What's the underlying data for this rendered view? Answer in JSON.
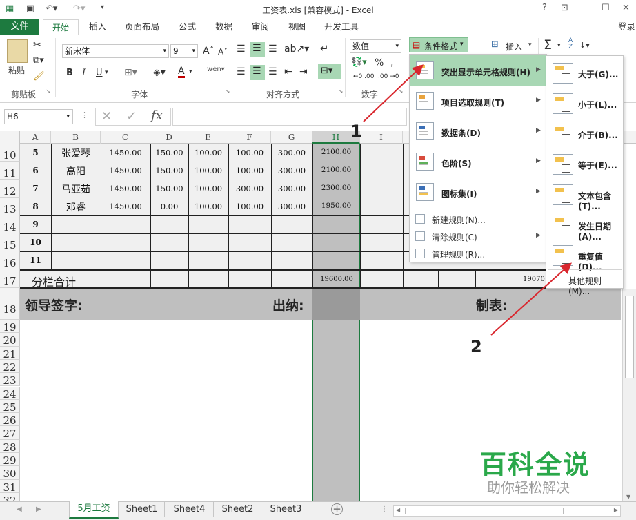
{
  "window": {
    "title": "工资表.xls  [兼容模式] - Excel",
    "help": "?",
    "login": "登录"
  },
  "tabs": {
    "file": "文件",
    "home": "开始",
    "insert": "插入",
    "layout": "页面布局",
    "formulas": "公式",
    "data": "数据",
    "review": "审阅",
    "view": "视图",
    "developer": "开发工具"
  },
  "ribbon": {
    "paste": "粘贴",
    "clipboard": "剪贴板",
    "font_name": "新宋体",
    "font_size": "9",
    "font_group": "字体",
    "bold": "B",
    "italic": "I",
    "underline": "U",
    "font_color": "A",
    "align_group": "对齐方式",
    "number_format": "数值",
    "number_group": "数字",
    "percent": "%",
    "cond_format": "条件格式",
    "insert_cells": "插入",
    "sigma": "Σ",
    "sort": "A Z"
  },
  "formula_bar": {
    "name_box": "H6",
    "fx": "fx",
    "cancel": "✕",
    "enter": "✓",
    "value": ""
  },
  "columns": [
    "A",
    "B",
    "C",
    "D",
    "E",
    "F",
    "G",
    "H",
    "I"
  ],
  "rows": [
    {
      "num": "10",
      "cells": [
        "5",
        "张爱琴",
        "1450.00",
        "150.00",
        "100.00",
        "100.00",
        "300.00",
        "2100.00"
      ]
    },
    {
      "num": "11",
      "cells": [
        "6",
        "高阳",
        "1450.00",
        "150.00",
        "100.00",
        "100.00",
        "300.00",
        "2100.00"
      ]
    },
    {
      "num": "12",
      "cells": [
        "7",
        "马亚茹",
        "1450.00",
        "150.00",
        "100.00",
        "300.00",
        "300.00",
        "2300.00"
      ]
    },
    {
      "num": "13",
      "cells": [
        "8",
        "邓睿",
        "1450.00",
        "0.00",
        "100.00",
        "100.00",
        "300.00",
        "1950.00"
      ]
    },
    {
      "num": "14",
      "cells": [
        "9",
        "",
        "",
        "",
        "",
        "",
        "",
        ""
      ]
    },
    {
      "num": "15",
      "cells": [
        "10",
        "",
        "",
        "",
        "",
        "",
        "",
        ""
      ]
    },
    {
      "num": "16",
      "cells": [
        "11",
        "",
        "",
        "",
        "",
        "",
        "",
        ""
      ]
    }
  ],
  "total_row": {
    "num": "17",
    "label": "分栏合计",
    "h_value": "19600.00",
    "far_value": "19070"
  },
  "sign_row": {
    "num": "18",
    "leader": "领导签字:",
    "cashier": "出纳:",
    "preparer": "制表:"
  },
  "empty_rows": [
    "19",
    "20",
    "21",
    "22",
    "23",
    "24",
    "25",
    "26",
    "27",
    "28",
    "29",
    "30",
    "31",
    "32"
  ],
  "cf_menu": {
    "items": [
      {
        "label": "突出显示单元格规则(H)",
        "highlighted": true
      },
      {
        "label": "项目选取规则(T)"
      },
      {
        "label": "数据条(D)"
      },
      {
        "label": "色阶(S)"
      },
      {
        "label": "图标集(I)"
      }
    ],
    "small": [
      {
        "label": "新建规则(N)..."
      },
      {
        "label": "清除规则(C)"
      },
      {
        "label": "管理规则(R)..."
      }
    ]
  },
  "sub_menu": {
    "items": [
      "大于(G)...",
      "小于(L)...",
      "介于(B)...",
      "等于(E)...",
      "文本包含(T)...",
      "发生日期(A)...",
      "重复值(D)..."
    ],
    "other": "其他规则(M)..."
  },
  "annotations": {
    "one": "1",
    "two": "2"
  },
  "watermark": {
    "main": "百科全说",
    "sub": "助你轻松解决"
  },
  "sheets": [
    "5月工资",
    "Sheet1",
    "Sheet4",
    "Sheet2",
    "Sheet3"
  ],
  "add_sheet": "+",
  "colors": {
    "accent": "#1d7a3f",
    "selected_col": "#bfbfbf",
    "arrow": "#d9272e"
  }
}
